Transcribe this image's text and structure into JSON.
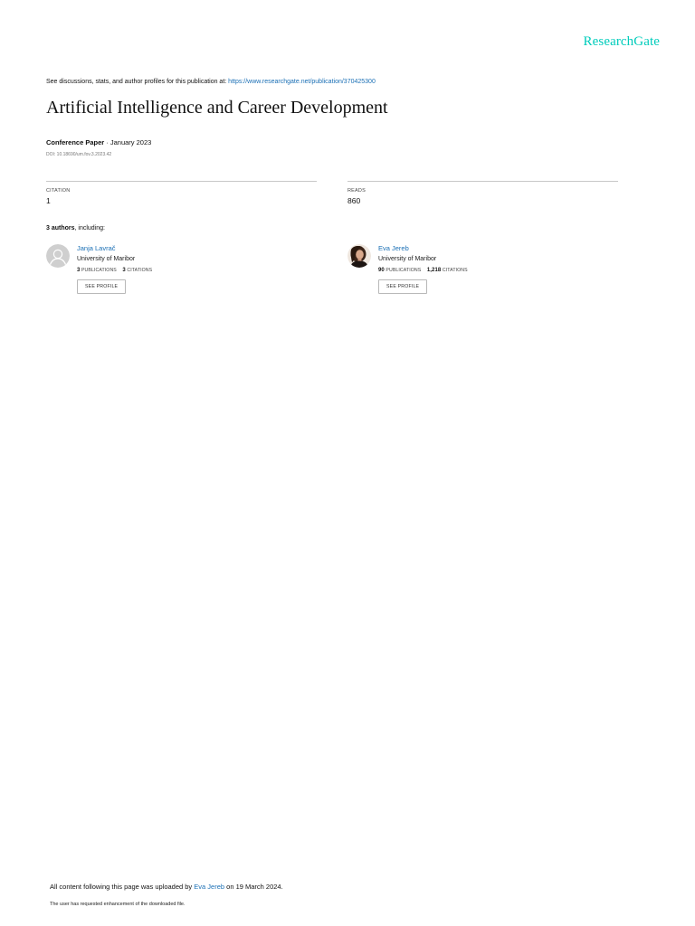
{
  "logo": "ResearchGate",
  "discussions": {
    "prefix": "See discussions, stats, and author profiles for this publication at: ",
    "url": "https://www.researchgate.net/publication/370425300"
  },
  "title": "Artificial Intelligence and Career Development",
  "meta": {
    "type": "Conference Paper",
    "sep": " · ",
    "date": "January 2023"
  },
  "doi": "DOI: 10.18690/um.fov.3.2023.42",
  "stats": {
    "citation_label": "CITATION",
    "citation_value": "1",
    "reads_label": "READS",
    "reads_value": "860"
  },
  "authors_heading": {
    "count": "3 authors",
    "suffix": ", including:"
  },
  "authors": [
    {
      "name": "Janja Lavrač",
      "institution": "University of Maribor",
      "publications": "3",
      "publications_label": "PUBLICATIONS",
      "citations": "3",
      "citations_label": "CITATIONS",
      "button": "SEE PROFILE",
      "avatar": "default-avatar-icon"
    },
    {
      "name": "Eva Jereb",
      "institution": "University of Maribor",
      "publications": "90",
      "publications_label": "PUBLICATIONS",
      "citations": "1,218",
      "citations_label": "CITATIONS",
      "button": "SEE PROFILE",
      "avatar": "author-photo"
    }
  ],
  "footer": {
    "prefix": "All content following this page was uploaded by ",
    "uploader": "Eva Jereb",
    "suffix": " on 19 March 2024.",
    "note": "The user has requested enhancement of the downloaded file."
  },
  "colors": {
    "brand": "#00ccbb",
    "link": "#1a6fb5"
  }
}
